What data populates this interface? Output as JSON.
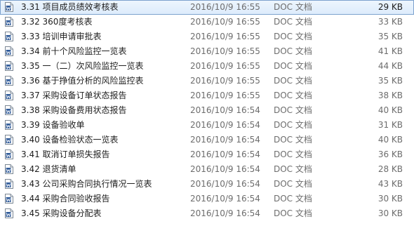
{
  "files": [
    {
      "name": "3.31 项目成员绩效考核表",
      "modified": "2016/10/9 16:55",
      "type": "DOC 文档",
      "size": "29 KB",
      "icon": "word-document-icon",
      "selected": true
    },
    {
      "name": "3.32  360度考核表",
      "modified": "2016/10/9 16:55",
      "type": "DOC 文档",
      "size": "33 KB",
      "icon": "word-document-icon",
      "selected": false
    },
    {
      "name": "3.33 培训申请审批表",
      "modified": "2016/10/9 16:55",
      "type": "DOC 文档",
      "size": "35 KB",
      "icon": "word-document-icon",
      "selected": false
    },
    {
      "name": "3.34 前十个风险监控一览表",
      "modified": "2016/10/9 16:55",
      "type": "DOC 文档",
      "size": "41 KB",
      "icon": "word-document-icon",
      "selected": false
    },
    {
      "name": "3.35 一（二）次风险监控一览表",
      "modified": "2016/10/9 16:55",
      "type": "DOC 文档",
      "size": "44 KB",
      "icon": "word-document-icon",
      "selected": false
    },
    {
      "name": "3.36 基于挣值分析的风险监控表",
      "modified": "2016/10/9 16:55",
      "type": "DOC 文档",
      "size": "35 KB",
      "icon": "word-document-icon",
      "selected": false
    },
    {
      "name": "3.37 采购设备订单状态报告",
      "modified": "2016/10/9 16:55",
      "type": "DOC 文档",
      "size": "38 KB",
      "icon": "word-document-icon",
      "selected": false
    },
    {
      "name": "3.38 采购设备费用状态报告",
      "modified": "2016/10/9 16:54",
      "type": "DOC 文档",
      "size": "40 KB",
      "icon": "word-document-icon",
      "selected": false
    },
    {
      "name": "3.39 设备验收单",
      "modified": "2016/10/9 16:54",
      "type": "DOC 文档",
      "size": "31 KB",
      "icon": "word-document-icon",
      "selected": false
    },
    {
      "name": "3.40 设备检验状态一览表",
      "modified": "2016/10/9 16:54",
      "type": "DOC 文档",
      "size": "40 KB",
      "icon": "word-document-icon",
      "selected": false
    },
    {
      "name": "3.41 取消订单损失报告",
      "modified": "2016/10/9 16:54",
      "type": "DOC 文档",
      "size": "36 KB",
      "icon": "word-document-icon",
      "selected": false
    },
    {
      "name": "3.42 退货清单",
      "modified": "2016/10/9 16:54",
      "type": "DOC 文档",
      "size": "28 KB",
      "icon": "word-document-icon",
      "selected": false
    },
    {
      "name": "3.43 公司采购合同执行情况一览表",
      "modified": "2016/10/9 16:54",
      "type": "DOC 文档",
      "size": "43 KB",
      "icon": "word-document-icon",
      "selected": false
    },
    {
      "name": "3.44 采购合同验收报告",
      "modified": "2016/10/9 16:54",
      "type": "DOC 文档",
      "size": "30 KB",
      "icon": "word-document-icon",
      "selected": false
    },
    {
      "name": "3.45 采购设备分配表",
      "modified": "2016/10/9 16:54",
      "type": "DOC 文档",
      "size": "30 KB",
      "icon": "word-document-icon",
      "selected": false
    }
  ],
  "colors": {
    "selection_border": "#7da2ce",
    "selection_fill": "#dcebfc",
    "icon_accent": "#2b5797",
    "muted_text": "#6d6d6d"
  }
}
